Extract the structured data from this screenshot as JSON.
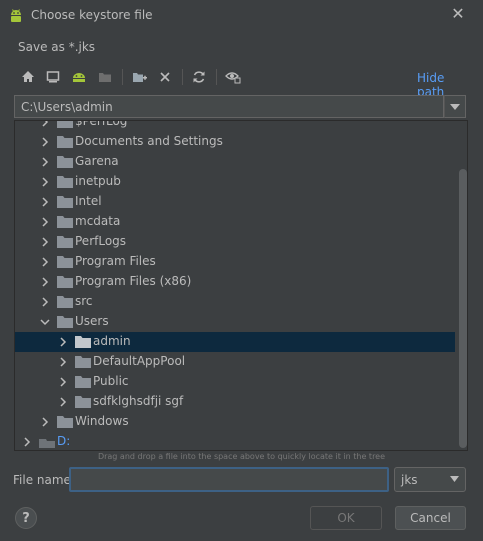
{
  "window": {
    "title": "Choose keystore file",
    "close_glyph": "✕"
  },
  "subtitle": "Save as *.jks",
  "toolbar": {
    "buttons": [
      {
        "name": "home-icon"
      },
      {
        "name": "desktop-icon"
      },
      {
        "name": "android-project-icon"
      },
      {
        "name": "module-folder-icon"
      },
      {
        "name": "new-folder-icon"
      },
      {
        "name": "delete-icon"
      },
      {
        "name": "refresh-icon"
      },
      {
        "name": "show-hidden-icon"
      }
    ],
    "hide_path": "Hide path"
  },
  "path": {
    "value": "C:\\Users\\admin"
  },
  "tree": {
    "partial_top_label": "$PerfLog",
    "rows": [
      {
        "label": "Documents and Settings",
        "level": 1,
        "expanded": false,
        "selected": false
      },
      {
        "label": "Garena",
        "level": 1,
        "expanded": false,
        "selected": false
      },
      {
        "label": "inetpub",
        "level": 1,
        "expanded": false,
        "selected": false
      },
      {
        "label": "Intel",
        "level": 1,
        "expanded": false,
        "selected": false
      },
      {
        "label": "mcdata",
        "level": 1,
        "expanded": false,
        "selected": false
      },
      {
        "label": "PerfLogs",
        "level": 1,
        "expanded": false,
        "selected": false
      },
      {
        "label": "Program Files",
        "level": 1,
        "expanded": false,
        "selected": false
      },
      {
        "label": "Program Files (x86)",
        "level": 1,
        "expanded": false,
        "selected": false
      },
      {
        "label": "src",
        "level": 1,
        "expanded": false,
        "selected": false
      },
      {
        "label": "Users",
        "level": 1,
        "expanded": true,
        "selected": false
      },
      {
        "label": "admin",
        "level": 2,
        "expanded": false,
        "selected": true
      },
      {
        "label": "DefaultAppPool",
        "level": 2,
        "expanded": false,
        "selected": false
      },
      {
        "label": "Public",
        "level": 2,
        "expanded": false,
        "selected": false
      },
      {
        "label": "sdfklghsdfji sgf",
        "level": 2,
        "expanded": false,
        "selected": false
      },
      {
        "label": "Windows",
        "level": 1,
        "expanded": false,
        "selected": false
      },
      {
        "label": "D:",
        "level": 0,
        "expanded": false,
        "selected": false,
        "drive": true
      }
    ]
  },
  "hint": "Drag and drop a file into the space above to quickly locate it in the tree",
  "file_name": {
    "label": "File name:",
    "value": ""
  },
  "extension": {
    "selected": "jks"
  },
  "buttons": {
    "help": "?",
    "ok": "OK",
    "cancel": "Cancel"
  },
  "colors": {
    "background": "#3c3f41",
    "accent_link": "#589df6",
    "selection": "#0d293e",
    "android_green": "#a4c639"
  }
}
